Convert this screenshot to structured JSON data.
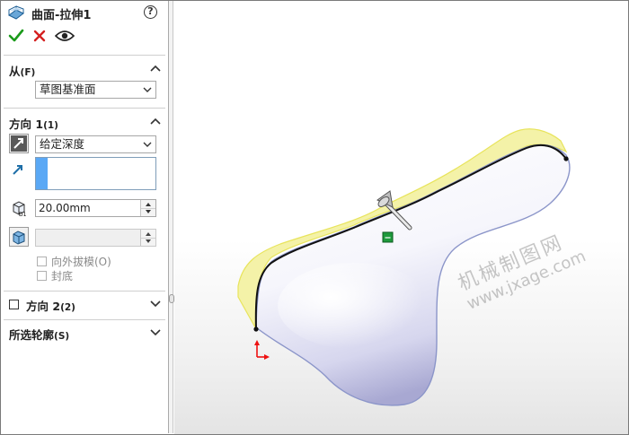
{
  "feature": {
    "title": "曲面-拉伸1",
    "help_glyph": "?",
    "icon": "surface-extrude-icon"
  },
  "actions": {
    "ok_icon": "check-icon",
    "cancel_icon": "close-icon",
    "preview_icon": "eye-icon"
  },
  "from_section": {
    "title": "从",
    "key": "(F)",
    "start_condition": "草图基准面"
  },
  "direction1": {
    "title": "方向 1",
    "key": "(1)",
    "end_condition": "给定深度",
    "depth": "20.00mm",
    "draft_outward": "向外拔模(O)",
    "cap_end": "封底"
  },
  "direction2": {
    "title": "方向 2",
    "key": "(2)"
  },
  "selected_contours": {
    "title": "所选轮廓",
    "key": "(S)"
  },
  "watermark": {
    "cn": "机械制图网",
    "url": "www.jxage.com"
  },
  "colors": {
    "ok": "#1a9a1a",
    "cancel": "#d42020",
    "selection_blue": "#5aa8f5",
    "preview_yellow": "#f2ef86",
    "surface_shade": "#c9c9e9"
  }
}
